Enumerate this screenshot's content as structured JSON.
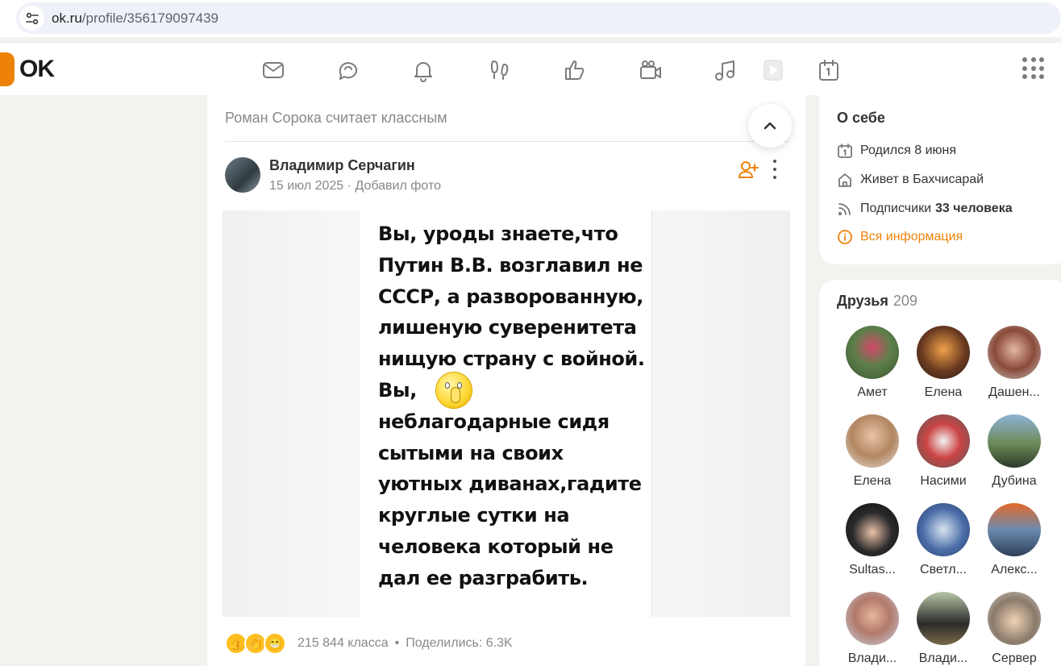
{
  "browser": {
    "url_host": "ok.ru",
    "url_path": "/profile/356179097439"
  },
  "header": {
    "logo": "OK"
  },
  "feed": {
    "liked_line": "Роман Сорока считает классным",
    "author": "Владимир Серчагин",
    "meta": "15 июл 2025 · Добавил фото",
    "post_text": "Вы, уроды знаете,что\nПутин В.В. возглавил не\nСССР, а разворованную,\nлишеную суверенитета\nнищую страну с войной.\nВы,\nнеблагодарные сидя\nсытыми на своих\nуютных диванах,гадите\nкруглые сутки на\nчеловека который не\nдал ее разграбить.",
    "likes": "215 844 класса",
    "shares": "Поделились: 6.3K"
  },
  "about": {
    "title": "О себе",
    "born": "Родился 8 июня",
    "lives": "Живет в Бахчисарай",
    "subscribers_label": "Подписчики",
    "subscribers_value": "33 человека",
    "all_info": "Вся информация"
  },
  "friends": {
    "title": "Друзья",
    "count": "209",
    "items": [
      {
        "name": "Амет"
      },
      {
        "name": "Елена"
      },
      {
        "name": "Дашен..."
      },
      {
        "name": "Елена"
      },
      {
        "name": "Насими"
      },
      {
        "name": "Дубина"
      },
      {
        "name": "Sultas..."
      },
      {
        "name": "Светл..."
      },
      {
        "name": "Алекс..."
      },
      {
        "name": "Влади..."
      },
      {
        "name": "Влади..."
      },
      {
        "name": "Сервер"
      }
    ]
  },
  "colors": {
    "accent": "#ee8208",
    "background": "#f4f2ef"
  }
}
